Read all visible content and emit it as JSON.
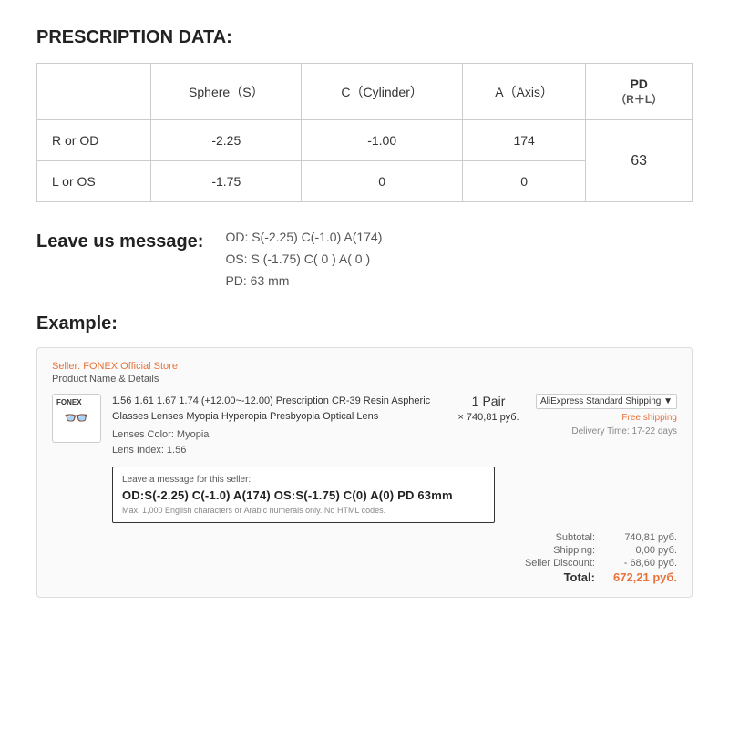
{
  "prescription": {
    "title": "PRESCRIPTION DATA:",
    "headers": {
      "col1": "Sphere（S）",
      "col2": "C（Cylinder）",
      "col3": "A（Axis）",
      "col4_main": "PD",
      "col4_sub": "（R＋L）"
    },
    "rows": [
      {
        "label": "R or OD",
        "sphere": "-2.25",
        "cylinder": "-1.00",
        "axis": "174",
        "pd": ""
      },
      {
        "label": "L or OS",
        "sphere": "-1.75",
        "cylinder": "0",
        "axis": "0",
        "pd": "63"
      }
    ]
  },
  "message_section": {
    "label": "Leave us message:",
    "lines": [
      "OD:  S(-2.25)    C(-1.0)   A(174)",
      "OS:  S (-1.75)    C( 0 )    A( 0 )",
      "PD:  63 mm"
    ]
  },
  "example": {
    "title": "Example:",
    "seller": "Seller: FONEX Official Store",
    "product_label": "Product Name & Details",
    "brand": "FONEX",
    "product_name": "1.56 1.61 1.67 1.74 (+12.00~-12.00) Prescription CR-39 Resin Aspheric Glasses Lenses Myopia Hyperopia Presbyopia Optical Lens",
    "lens_color": "Lenses Color:  Myopia",
    "lens_index": "Lens Index:  1.56",
    "qty": "1",
    "qty_unit": "Pair",
    "price": "× 740,81 руб.",
    "shipping_option": "AliExpress Standard Shipping ▼",
    "free_shipping": "Free shipping",
    "delivery": "Delivery Time: 17-22 days",
    "message_label": "Leave a message for this seller:",
    "message_text": "OD:S(-2.25) C(-1.0) A(174)  OS:S(-1.75) C(0) A(0)  PD  63mm",
    "message_limit": "Max. 1,000 English characters or Arabic numerals only. No HTML codes.",
    "totals": {
      "subtotal_label": "Subtotal:",
      "subtotal_value": "740,81 руб.",
      "shipping_label": "Shipping:",
      "shipping_value": "0,00 руб.",
      "discount_label": "Seller Discount:",
      "discount_value": "- 68,60 руб.",
      "total_label": "Total:",
      "total_value": "672,21 руб."
    }
  }
}
